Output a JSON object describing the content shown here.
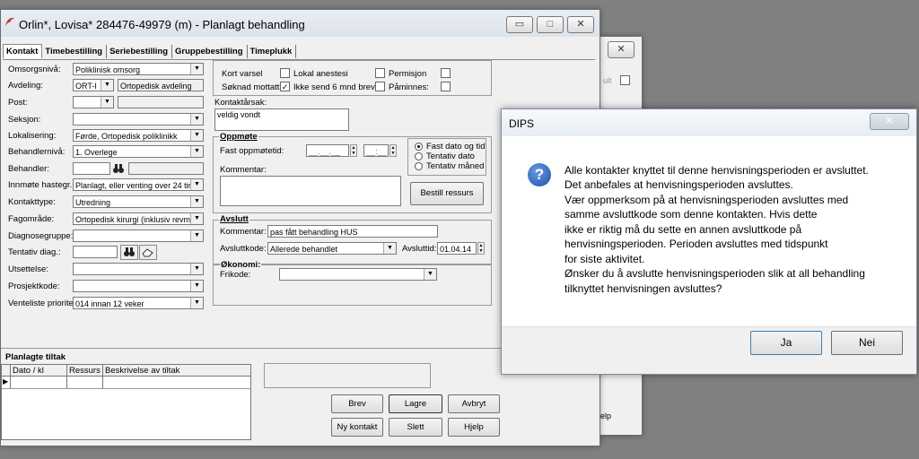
{
  "main_window": {
    "title": "Orlin*, Lovisa*  284476-49979 (m) - Planlagt behandling",
    "controls": {
      "minimize": "▭",
      "maximize": "□",
      "close": "✕"
    }
  },
  "tabs": [
    {
      "label": "Kontakt"
    },
    {
      "label": "Timebestilling"
    },
    {
      "label": "Seriebestilling"
    },
    {
      "label": "Gruppebestilling"
    },
    {
      "label": "Timeplukk"
    }
  ],
  "left_form": {
    "omsorgsniva": {
      "label": "Omsorgsnivå:",
      "value": "Poliklinisk omsorg"
    },
    "avdeling": {
      "label": "Avdeling:",
      "code": "ORT-I",
      "value": "Ortopedisk avdeling"
    },
    "post": {
      "label": "Post:",
      "value": ""
    },
    "seksjon": {
      "label": "Seksjon:",
      "value": ""
    },
    "lokalisering": {
      "label": "Lokalisering:",
      "value": "Førde, Ortopedisk poliklinikk"
    },
    "behandlerniva": {
      "label": "Behandlernivå:",
      "value": "1. Overlege"
    },
    "behandler": {
      "label": "Behandler:",
      "value": ""
    },
    "innmote": {
      "label": "Innmøte hastegr.:",
      "value": "Planlagt, eller venting over 24 tir"
    },
    "kontakttype": {
      "label": "Kontakttype:",
      "value": "Utredning"
    },
    "fagomrade": {
      "label": "Fagområde:",
      "value": "Ortopedisk kirurgi (inklusiv revm"
    },
    "diagnosegruppe": {
      "label": "Diagnosegruppe:",
      "value": ""
    },
    "tentativ_diag": {
      "label": "Tentativ diag.:",
      "value": ""
    },
    "utsettelse": {
      "label": "Utsettelse:",
      "value": ""
    },
    "prosjektkode": {
      "label": "Prosjektkode:",
      "value": ""
    },
    "venteliste": {
      "label": "Venteliste prioritet:",
      "value": "014 innan 12 veker"
    }
  },
  "checkboxes": {
    "kort_varsel": {
      "label": "Kort varsel",
      "checked": ""
    },
    "lokal_anestesi": {
      "label": "Lokal anestesi",
      "checked": ""
    },
    "permisjon": {
      "label": "Permisjon",
      "checked": ""
    },
    "soknad_mottatt": {
      "label": "Søknad mottatt",
      "checked": "✓"
    },
    "ikke_send": {
      "label": "Ikke send 6 mnd brev",
      "checked": ""
    },
    "paminnes": {
      "label": "Påminnes:",
      "checked": ""
    }
  },
  "kontaktarsak": {
    "label": "Kontaktårsak:",
    "value": "veldig vondt"
  },
  "oppmote": {
    "heading": "Oppmøte",
    "fast_label": "Fast oppmøtetid:",
    "date_placeholder": "__.__.__",
    "time_placeholder": "__:__",
    "kommentar_label": "Kommentar:",
    "radios": [
      {
        "label": "Fast dato og tid",
        "selected": true
      },
      {
        "label": "Tentativ dato",
        "selected": false
      },
      {
        "label": "Tentativ måned",
        "selected": false
      }
    ],
    "bestill_button": "Bestill ressurs"
  },
  "avslutt": {
    "heading": "Avslutt",
    "kommentar_label": "Kommentar:",
    "kommentar_value": "pas fått behandling HUS",
    "kode_label": "Avsluttkode:",
    "kode_value": "Allerede behandlet",
    "tid_label": "Avsluttid:",
    "tid_value": "01.04.14"
  },
  "okonomi": {
    "heading": "Økonomi:",
    "frikode_label": "Frikode:",
    "frikode_value": ""
  },
  "planlagte_tiltak": {
    "heading": "Planlagte tiltak",
    "columns": [
      "Dato / kl",
      "Ressurs",
      "Beskrivelse av tiltak"
    ],
    "row_marker": "▶"
  },
  "bottom_buttons": {
    "brev": "Brev",
    "lagre": "Lagre",
    "avbryt": "Avbryt",
    "ny_kontakt": "Ny kontakt",
    "slett": "Slett",
    "hjelp": "Hjelp"
  },
  "background_window": {
    "partial_text_1": "ult",
    "partial_text_2": "elp",
    "close": "✕"
  },
  "dialog": {
    "title": "DIPS",
    "close": "✕",
    "icon": "question-icon",
    "icon_glyph": "?",
    "message_lines": [
      "Alle kontakter knyttet til denne henvisningsperioden er avsluttet.",
      "Det anbefales at henvisningsperioden avsluttes.",
      "Vær oppmerksom på at henvisningsperioden avsluttes med",
      "samme avsluttkode som denne kontakten. Hvis dette",
      "ikke er riktig må du sette en annen avsluttkode på",
      "henvisningsperioden. Perioden avsluttes med tidspunkt",
      "for siste aktivitet.",
      "Ønsker du å avslutte henvisningsperioden slik at all behandling",
      "tilknyttet henvisningen avsluttes?"
    ],
    "yes_button": "Ja",
    "no_button": "Nei"
  },
  "colors": {
    "accent": "#1f5fbf",
    "window_bg": "#f0f0f0",
    "desktop": "#808080"
  }
}
